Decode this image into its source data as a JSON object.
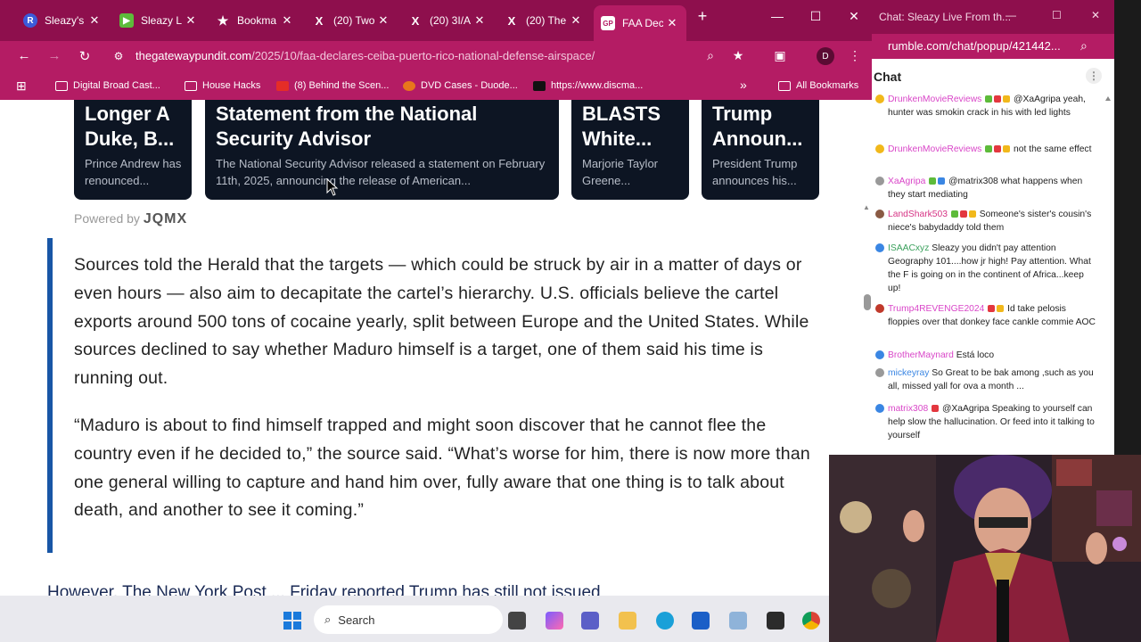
{
  "browser": {
    "tabs": [
      {
        "title": "Sleazy's",
        "icon": "R",
        "icon_color": "#3b5bdb"
      },
      {
        "title": "Sleazy Li",
        "icon": "▶",
        "icon_color": "#5dbb3a"
      },
      {
        "title": "Bookma",
        "icon": "★",
        "icon_color": "#8e0f4d"
      },
      {
        "title": "(20) Two",
        "icon": "X",
        "icon_color": "#000000"
      },
      {
        "title": "(20) 3I/A",
        "icon": "X",
        "icon_color": "#000000"
      },
      {
        "title": "(20) The",
        "icon": "X",
        "icon_color": "#000000"
      },
      {
        "title": "FAA Dec",
        "icon": "GP",
        "icon_color": "#ffffff"
      }
    ],
    "new_tab": "+",
    "window_controls": {
      "minimize": "—",
      "maximize": "☐",
      "close": "✕"
    },
    "url_domain": "thegatewaypundit.com",
    "url_path": "/2025/10/faa-declares-ceiba-puerto-rico-national-defense-airspace/",
    "profile_initial": "D",
    "bookmarks": [
      {
        "label": "Digital Broad Cast..."
      },
      {
        "label": "House Hacks"
      },
      {
        "label": "(8) Behind the Scen..."
      },
      {
        "label": "DVD Cases - Duode..."
      },
      {
        "label": "https://www.discma..."
      }
    ],
    "bookmarks_more": "»",
    "all_bookmarks": "All Bookmarks"
  },
  "page": {
    "cards": [
      {
        "title": "Longer A Duke, B...",
        "desc": "Prince Andrew has renounced..."
      },
      {
        "title": "Statement from the National Security Advisor",
        "desc": "The National Security Advisor released a statement on February 11th, 2025, announcing the release of American..."
      },
      {
        "title": "BLASTS White...",
        "desc": "Marjorie Taylor Greene..."
      },
      {
        "title": "Trump Announ...",
        "desc": "President Trump announces his..."
      }
    ],
    "powered_by": "Powered by",
    "powered_logo": "JQMX",
    "quote_p1": "Sources told the Herald that the targets — which could be struck by air in a matter of days or even hours — also aim to decapitate the cartel’s hierarchy. U.S. officials believe the cartel exports around 500 tons of cocaine yearly, split between Europe and the United States. While sources declined to say whether Maduro himself is a target, one of them said his time is running out.",
    "quote_p2": "“Maduro is about to find himself trapped and might soon discover that he cannot flee the country even if he decided to,” the source said. “What’s worse for him, there is now more than one general willing to capture and hand him over, fully aware that one thing is to talk about death, and another to see it coming.”",
    "cut_line": "However, The New York Post ... Friday reported Trump has still not issued"
  },
  "chat": {
    "window_title": "Chat: Sleazy Live From th...",
    "url": "rumble.com/chat/popup/421442...",
    "header": "Chat",
    "messages": [
      {
        "user": "DrunkenMovieReviews",
        "user_color": "#d946c8",
        "avatar_color": "#f1b81b",
        "badges": [
          "g",
          "r",
          "y"
        ],
        "text": "@XaAgripa yeah, hunter was smokin crack in his with led lights"
      },
      {
        "user": "DrunkenMovieReviews",
        "user_color": "#d946c8",
        "avatar_color": "#f1b81b",
        "badges": [
          "g",
          "r",
          "y"
        ],
        "text": "not the same effect"
      },
      {
        "user": "XaAgripa",
        "user_color": "#d946c8",
        "avatar_color": "#999999",
        "badges": [
          "g",
          "b"
        ],
        "text": "@matrix308 what happens when they start mediating"
      },
      {
        "user": "LandShark503",
        "user_color": "#d63384",
        "avatar_color": "#8a5a44",
        "badges": [
          "g",
          "r",
          "y"
        ],
        "text": "Someone's sister's cousin's niece's babydaddy told them"
      },
      {
        "user": "ISAACxyz",
        "user_color": "#3aa05c",
        "avatar_color": "#3a86e3",
        "badges": [],
        "text": "Sleazy you didn't pay attention Geography 101....how jr high! Pay attention. What the F is going on in the continent of Africa...keep up!"
      },
      {
        "user": "Trump4REVENGE2024",
        "user_color": "#d946c8",
        "avatar_color": "#c0392b",
        "badges": [
          "r",
          "y"
        ],
        "text": "Id take pelosis floppies over that donkey face cankle commie AOC"
      },
      {
        "user": "BrotherMaynard",
        "user_color": "#d946c8",
        "avatar_color": "#3a86e3",
        "badges": [],
        "text": "Está loco"
      },
      {
        "user": "mickeyray",
        "user_color": "#3a86e3",
        "avatar_color": "#999999",
        "badges": [],
        "text": "So Great to be bak among ,such as you all, missed yall for ova a month ..."
      },
      {
        "user": "matrix308",
        "user_color": "#d946c8",
        "avatar_color": "#3a86e3",
        "badges": [
          "r"
        ],
        "text": "@XaAgripa Speaking to yourself can help slow the hallucination. Or feed into it talking to yourself"
      }
    ]
  },
  "taskbar": {
    "search_label": "Search"
  }
}
